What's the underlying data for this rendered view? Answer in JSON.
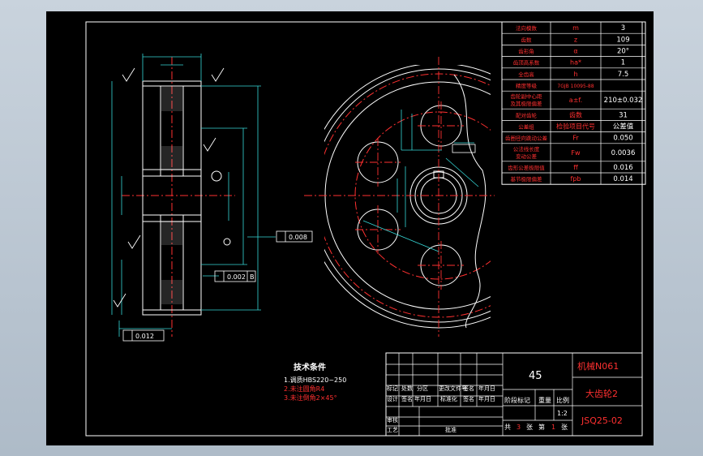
{
  "drawing": {
    "material": "45",
    "company": "机械N061",
    "part_name": "大齿轮2",
    "drawing_no": "JSQ25-02",
    "scale": "1:2"
  },
  "title_block": {
    "row_labels_1": [
      "标记",
      "处数",
      "分区",
      "更改文件号",
      "签名",
      "年月日"
    ],
    "row_labels_2": [
      "设计",
      "签名",
      "年月日",
      "标准化",
      "签名",
      "年月日"
    ],
    "stage_mark": "阶段标记",
    "weight": "重量",
    "scale_label": "比例",
    "review": "审核",
    "process": "工艺",
    "approve": "批准",
    "sheet_total_prefix": "共",
    "sheet_total": "3",
    "sheet_total_suffix": "张",
    "sheet_no_prefix": "第",
    "sheet_no": "1",
    "sheet_no_suffix": "张"
  },
  "tech_req": {
    "title": "技术条件",
    "items": [
      {
        "text": "1.调质HBS220~250",
        "color": "#ffffff"
      },
      {
        "text": "2.未注圆角R4",
        "color": "#ff3030"
      },
      {
        "text": "3.未注倒角2×45°",
        "color": "#ff3030"
      }
    ]
  },
  "param_table": [
    {
      "name": "法向模数",
      "sym": "m",
      "val": "3"
    },
    {
      "name": "齿数",
      "sym": "z",
      "val": "109"
    },
    {
      "name": "齿形角",
      "sym": "α",
      "val": "20°"
    },
    {
      "name": "齿顶高系数",
      "sym": "ha*",
      "val": "1"
    },
    {
      "name": "全齿高",
      "sym": "h",
      "val": "7.5"
    },
    {
      "name": "精度等级",
      "sym": "7GJB 10095-88",
      "val": ""
    },
    {
      "name": "齿轮副中心距及其极限偏差",
      "sym": "a±f.",
      "val": "210±0.032"
    },
    {
      "name": "配对齿轮",
      "sym": "齿数",
      "val": "31"
    },
    {
      "name": "公差组",
      "sym": "检验项目代号",
      "val": "公差值"
    },
    {
      "name": "齿圈径向跳动公差",
      "sym": "Fr",
      "val": "0.050"
    },
    {
      "name": "公法线长度变动公差",
      "sym": "Fw",
      "val": "0.0036"
    },
    {
      "name": "齿形公差极限值",
      "sym": "ff",
      "val": "0.016"
    },
    {
      "name": "基节极限偏差",
      "sym": "fpb",
      "val": "0.014"
    }
  ],
  "annotations": {
    "runout_1": "0.008",
    "runout_2": "0.002",
    "runout_3": "0.012",
    "datum": "B"
  },
  "colors": {
    "line": "#ffffff",
    "center": "#ff3030",
    "dim": "#35d7d7",
    "text_red": "#ff3030",
    "table_text": "#ff3030"
  }
}
